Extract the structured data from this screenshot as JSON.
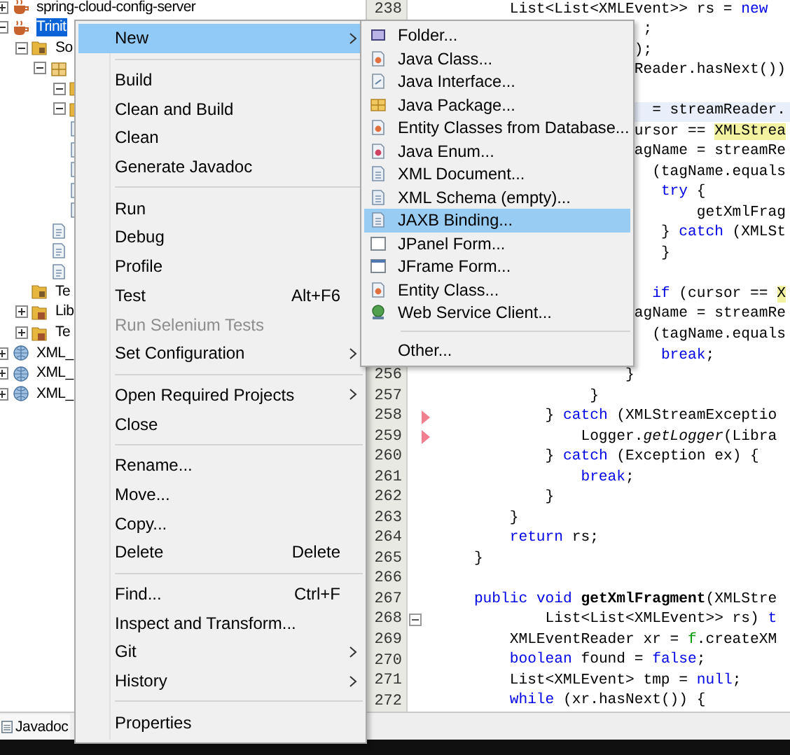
{
  "project_tree": [
    {
      "label": "spring-cloud-config-server",
      "kind": "project",
      "expanded": false,
      "selected": false
    },
    {
      "label": "Trinit",
      "kind": "project",
      "expanded": true,
      "selected": true,
      "children": [
        {
          "label": "So",
          "kind": "source",
          "expanded": true,
          "selected": false,
          "children": [
            {
              "kind": "package",
              "expanded": true,
              "selected": false,
              "children": [
                {
                  "kind": "folder",
                  "expanded": true,
                  "selected": false
                },
                {
                  "kind": "folder",
                  "expanded": true,
                  "selected": false
                },
                {
                  "kind": "file",
                  "selected": false
                },
                {
                  "kind": "file",
                  "selected": false
                },
                {
                  "kind": "file",
                  "selected": false
                },
                {
                  "kind": "file",
                  "selected": false
                },
                {
                  "kind": "file",
                  "selected": false
                }
              ]
            },
            {
              "kind": "file",
              "selected": false
            },
            {
              "kind": "file",
              "selected": false
            },
            {
              "kind": "file",
              "selected": false
            }
          ]
        },
        {
          "label": "Te",
          "kind": "source",
          "selected": false
        },
        {
          "label": "Lib",
          "kind": "library",
          "expanded": false,
          "selected": false
        },
        {
          "label": "Te",
          "kind": "library",
          "expanded": false,
          "selected": false
        }
      ]
    },
    {
      "label": "XML_",
      "kind": "web",
      "expanded": false,
      "selected": false
    },
    {
      "label": "XML_",
      "kind": "web",
      "expanded": false,
      "selected": false
    },
    {
      "label": "XML_",
      "kind": "web",
      "expanded": false,
      "selected": false
    }
  ],
  "editor": {
    "lines": [
      {
        "number": "238",
        "current": false,
        "fold_marker": false,
        "error_mark": false,
        "parts": [
          {
            "text": "        List<List<XMLEvent>> rs = ",
            "kind": "plain"
          },
          {
            "text": "new",
            "kind": "keyword"
          }
        ]
      },
      {
        "current": false,
        "fold_marker": false,
        "error_mark": false,
        "parts": [
          {
            "text": "                       ;",
            "kind": "plain"
          }
        ]
      },
      {
        "current": false,
        "fold_marker": false,
        "error_mark": false,
        "parts": [
          {
            "text": "                      );",
            "kind": "plain"
          }
        ]
      },
      {
        "current": false,
        "fold_marker": false,
        "error_mark": false,
        "parts": [
          {
            "text": "                      Reader.hasNext())",
            "kind": "plain"
          }
        ]
      },
      {
        "current": false,
        "fold_marker": false,
        "error_mark": false
      },
      {
        "current": true,
        "fold_marker": false,
        "error_mark": false,
        "parts": [
          {
            "text": "                        = streamReader.",
            "kind": "plain"
          }
        ]
      },
      {
        "current": false,
        "fold_marker": false,
        "error_mark": false,
        "parts": [
          {
            "text": "                      ursor == ",
            "kind": "plain"
          },
          {
            "text": "XMLStrea",
            "kind": "highlight"
          }
        ]
      },
      {
        "current": false,
        "fold_marker": false,
        "error_mark": false,
        "parts": [
          {
            "text": "                      agName = streamRe",
            "kind": "plain"
          }
        ]
      },
      {
        "current": false,
        "fold_marker": false,
        "error_mark": false,
        "parts": [
          {
            "text": "                        (tagName.equals",
            "kind": "plain"
          }
        ]
      },
      {
        "current": false,
        "fold_marker": false,
        "error_mark": false,
        "parts": [
          {
            "text": "                         try",
            "kind": "keyword"
          },
          {
            "text": " {",
            "kind": "plain"
          }
        ]
      },
      {
        "current": false,
        "fold_marker": false,
        "error_mark": false,
        "parts": [
          {
            "text": "                             getXmlFrag",
            "kind": "plain"
          }
        ]
      },
      {
        "current": false,
        "fold_marker": false,
        "error_mark": false,
        "parts": [
          {
            "text": "                         } ",
            "kind": "plain"
          },
          {
            "text": "catch",
            "kind": "keyword"
          },
          {
            "text": " (XMLSt",
            "kind": "plain"
          }
        ]
      },
      {
        "current": false,
        "fold_marker": false,
        "error_mark": false,
        "parts": [
          {
            "text": "                         }",
            "kind": "plain"
          }
        ]
      },
      {
        "current": false,
        "fold_marker": false,
        "error_mark": false
      },
      {
        "current": false,
        "fold_marker": false,
        "error_mark": false,
        "parts": [
          {
            "text": "                        if",
            "kind": "keyword"
          },
          {
            "text": " (cursor == ",
            "kind": "plain"
          },
          {
            "text": "X",
            "kind": "highlight"
          }
        ]
      },
      {
        "current": false,
        "fold_marker": false,
        "error_mark": false,
        "parts": [
          {
            "text": "                      agName = streamRe",
            "kind": "plain"
          }
        ]
      },
      {
        "current": false,
        "fold_marker": false,
        "error_mark": false,
        "parts": [
          {
            "text": "                        (tagName.equals",
            "kind": "plain"
          }
        ]
      },
      {
        "current": false,
        "fold_marker": false,
        "error_mark": false,
        "parts": [
          {
            "text": "                         break",
            "kind": "keyword"
          },
          {
            "text": ";",
            "kind": "plain"
          }
        ]
      },
      {
        "number": "256",
        "current": false,
        "fold_marker": false,
        "error_mark": false,
        "parts": [
          {
            "text": "                     }",
            "kind": "plain"
          }
        ]
      },
      {
        "number": "257",
        "current": false,
        "fold_marker": false,
        "error_mark": false,
        "parts": [
          {
            "text": "                 }",
            "kind": "plain"
          }
        ]
      },
      {
        "number": "258",
        "current": false,
        "fold_marker": false,
        "error_mark": true,
        "parts": [
          {
            "text": "            } ",
            "kind": "plain"
          },
          {
            "text": "catch",
            "kind": "keyword"
          },
          {
            "text": " (XMLStreamExceptio",
            "kind": "plain"
          }
        ]
      },
      {
        "number": "259",
        "current": false,
        "fold_marker": false,
        "error_mark": true,
        "parts": [
          {
            "text": "                Logger.",
            "kind": "plain"
          },
          {
            "text": "getLogger",
            "kind": "italic"
          },
          {
            "text": "(Libra",
            "kind": "plain"
          }
        ]
      },
      {
        "number": "260",
        "current": false,
        "fold_marker": false,
        "error_mark": false,
        "parts": [
          {
            "text": "            } ",
            "kind": "plain"
          },
          {
            "text": "catch",
            "kind": "keyword"
          },
          {
            "text": " (Exception ex) {",
            "kind": "plain"
          }
        ]
      },
      {
        "number": "261",
        "current": false,
        "fold_marker": false,
        "error_mark": false,
        "parts": [
          {
            "text": "                break",
            "kind": "keyword"
          },
          {
            "text": ";",
            "kind": "plain"
          }
        ]
      },
      {
        "number": "262",
        "current": false,
        "fold_marker": false,
        "error_mark": false,
        "parts": [
          {
            "text": "            }",
            "kind": "plain"
          }
        ]
      },
      {
        "number": "263",
        "current": false,
        "fold_marker": false,
        "error_mark": false,
        "parts": [
          {
            "text": "        }",
            "kind": "plain"
          }
        ]
      },
      {
        "number": "264",
        "current": false,
        "fold_marker": false,
        "error_mark": false,
        "parts": [
          {
            "text": "        return",
            "kind": "keyword"
          },
          {
            "text": " rs;",
            "kind": "plain"
          }
        ]
      },
      {
        "number": "265",
        "current": false,
        "fold_marker": false,
        "error_mark": false,
        "parts": [
          {
            "text": "    }",
            "kind": "plain"
          }
        ]
      },
      {
        "number": "266",
        "current": false,
        "fold_marker": false,
        "error_mark": false
      },
      {
        "number": "267",
        "current": false,
        "fold_marker": false,
        "error_mark": false,
        "parts": [
          {
            "text": "    public void",
            "kind": "keyword"
          },
          {
            "text": " getXmlFragment",
            "kind": "bold"
          },
          {
            "text": "(XMLStre",
            "kind": "plain"
          }
        ]
      },
      {
        "number": "268",
        "current": false,
        "fold_marker": true,
        "error_mark": false,
        "parts": [
          {
            "text": "            List<List<XMLEvent>> rs) ",
            "kind": "plain"
          },
          {
            "text": "t",
            "kind": "keyword"
          }
        ]
      },
      {
        "number": "269",
        "current": false,
        "fold_marker": false,
        "error_mark": false,
        "parts": [
          {
            "text": "        XMLEventReader xr = ",
            "kind": "plain"
          },
          {
            "text": "f",
            "kind": "field"
          },
          {
            "text": ".createXM",
            "kind": "plain"
          }
        ]
      },
      {
        "number": "270",
        "current": false,
        "fold_marker": false,
        "error_mark": false,
        "parts": [
          {
            "text": "        boolean",
            "kind": "keyword"
          },
          {
            "text": " found = ",
            "kind": "plain"
          },
          {
            "text": "false",
            "kind": "keyword"
          },
          {
            "text": ";",
            "kind": "plain"
          }
        ]
      },
      {
        "number": "271",
        "current": false,
        "fold_marker": false,
        "error_mark": false,
        "parts": [
          {
            "text": "        List<XMLEvent> tmp = ",
            "kind": "plain"
          },
          {
            "text": "null",
            "kind": "keyword"
          },
          {
            "text": ";",
            "kind": "plain"
          }
        ]
      },
      {
        "number": "272",
        "current": false,
        "fold_marker": false,
        "error_mark": false,
        "parts": [
          {
            "text": "        while",
            "kind": "keyword"
          },
          {
            "text": " (xr.hasNext()) {",
            "kind": "plain"
          }
        ]
      }
    ]
  },
  "bottom_tabs": [
    {
      "label": "Javadoc"
    }
  ],
  "context_menu": {
    "items": [
      {
        "kind": "item",
        "label": "New",
        "has_submenu": true,
        "disabled": false,
        "selected": true
      },
      {
        "kind": "separator"
      },
      {
        "kind": "item",
        "label": "Build",
        "has_submenu": false,
        "disabled": false,
        "selected": false
      },
      {
        "kind": "item",
        "label": "Clean and Build",
        "has_submenu": false,
        "disabled": false,
        "selected": false
      },
      {
        "kind": "item",
        "label": "Clean",
        "has_submenu": false,
        "disabled": false,
        "selected": false
      },
      {
        "kind": "item",
        "label": "Generate Javadoc",
        "has_submenu": false,
        "disabled": false,
        "selected": false
      },
      {
        "kind": "separator"
      },
      {
        "kind": "item",
        "label": "Run",
        "has_submenu": false,
        "disabled": false,
        "selected": false
      },
      {
        "kind": "item",
        "label": "Debug",
        "has_submenu": false,
        "disabled": false,
        "selected": false
      },
      {
        "kind": "item",
        "label": "Profile",
        "has_submenu": false,
        "disabled": false,
        "selected": false
      },
      {
        "kind": "item",
        "label": "Test",
        "shortcut": "Alt+F6",
        "has_submenu": false,
        "disabled": false,
        "selected": false
      },
      {
        "kind": "item",
        "label": "Run Selenium Tests",
        "has_submenu": false,
        "disabled": true,
        "selected": false
      },
      {
        "kind": "item",
        "label": "Set Configuration",
        "has_submenu": true,
        "disabled": false,
        "selected": false
      },
      {
        "kind": "separator"
      },
      {
        "kind": "item",
        "label": "Open Required Projects",
        "has_submenu": true,
        "disabled": false,
        "selected": false
      },
      {
        "kind": "item",
        "label": "Close",
        "has_submenu": false,
        "disabled": false,
        "selected": false
      },
      {
        "kind": "separator"
      },
      {
        "kind": "item",
        "label": "Rename...",
        "has_submenu": false,
        "disabled": false,
        "selected": false
      },
      {
        "kind": "item",
        "label": "Move...",
        "has_submenu": false,
        "disabled": false,
        "selected": false
      },
      {
        "kind": "item",
        "label": "Copy...",
        "has_submenu": false,
        "disabled": false,
        "selected": false
      },
      {
        "kind": "item",
        "label": "Delete",
        "shortcut": "Delete",
        "has_submenu": false,
        "disabled": false,
        "selected": false
      },
      {
        "kind": "separator"
      },
      {
        "kind": "item",
        "label": "Find...",
        "shortcut": "Ctrl+F",
        "has_submenu": false,
        "disabled": false,
        "selected": false
      },
      {
        "kind": "item",
        "label": "Inspect and Transform...",
        "has_submenu": false,
        "disabled": false,
        "selected": false
      },
      {
        "kind": "item",
        "label": "Git",
        "has_submenu": true,
        "disabled": false,
        "selected": false
      },
      {
        "kind": "item",
        "label": "History",
        "has_submenu": true,
        "disabled": false,
        "selected": false
      },
      {
        "kind": "separator"
      },
      {
        "kind": "item",
        "label": "Properties",
        "has_submenu": false,
        "disabled": false,
        "selected": false
      }
    ]
  },
  "new_submenu": {
    "items": [
      {
        "kind": "folder",
        "label": "Folder...",
        "selected": false
      },
      {
        "kind": "class",
        "label": "Java Class...",
        "selected": false
      },
      {
        "kind": "interface",
        "label": "Java Interface...",
        "selected": false
      },
      {
        "kind": "package",
        "label": "Java Package...",
        "selected": false
      },
      {
        "kind": "class",
        "label": "Entity Classes from Database...",
        "selected": false
      },
      {
        "kind": "enum",
        "label": "Java Enum...",
        "selected": false
      },
      {
        "kind": "xml",
        "label": "XML Document...",
        "selected": false
      },
      {
        "kind": "xml",
        "label": "XML Schema (empty)...",
        "selected": false
      },
      {
        "kind": "xml",
        "label": "JAXB Binding...",
        "selected": true
      },
      {
        "kind": "panel",
        "label": "JPanel Form...",
        "selected": false
      },
      {
        "kind": "frame",
        "label": "JFrame Form...",
        "selected": false
      },
      {
        "kind": "class",
        "label": "Entity Class...",
        "selected": false
      },
      {
        "kind": "globe",
        "label": "Web Service Client...",
        "selected": false
      },
      {
        "kind": "separator"
      },
      {
        "kind": "plain",
        "label": "Other...",
        "selected": false
      }
    ]
  }
}
